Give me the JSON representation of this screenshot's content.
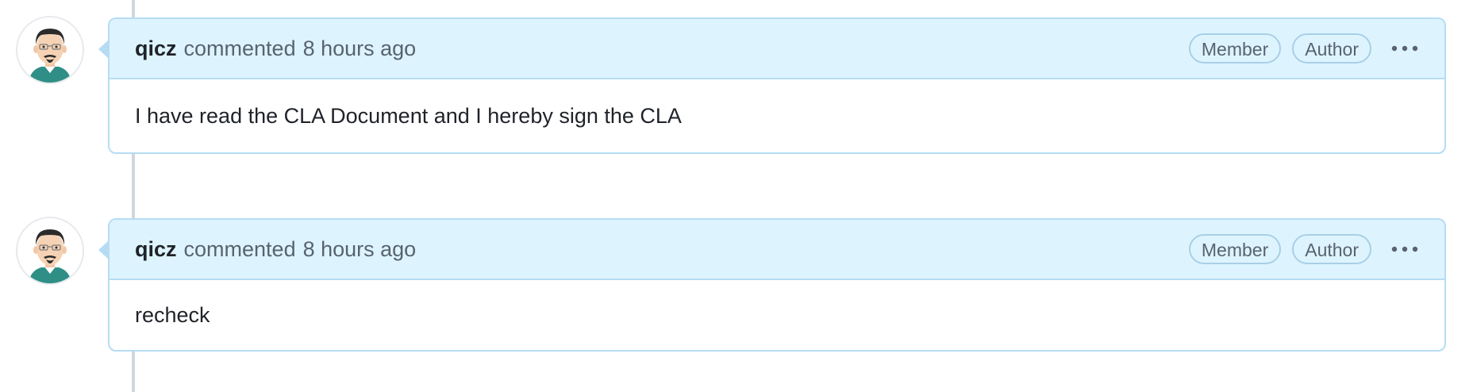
{
  "comments": [
    {
      "author": "qicz",
      "action": "commented",
      "time": "8 hours ago",
      "badges": [
        "Member",
        "Author"
      ],
      "body": "I have read the CLA Document and I hereby sign the CLA"
    },
    {
      "author": "qicz",
      "action": "commented",
      "time": "8 hours ago",
      "badges": [
        "Member",
        "Author"
      ],
      "body": "recheck"
    }
  ],
  "icons": {
    "avatar": "user-avatar-icon",
    "menu": "kebab-horizontal-icon"
  },
  "colors": {
    "header_bg": "#ddf4ff",
    "border": "#b6dcf4",
    "muted_text": "#59636e",
    "text": "#1f2328",
    "timeline": "#d0d7de"
  }
}
